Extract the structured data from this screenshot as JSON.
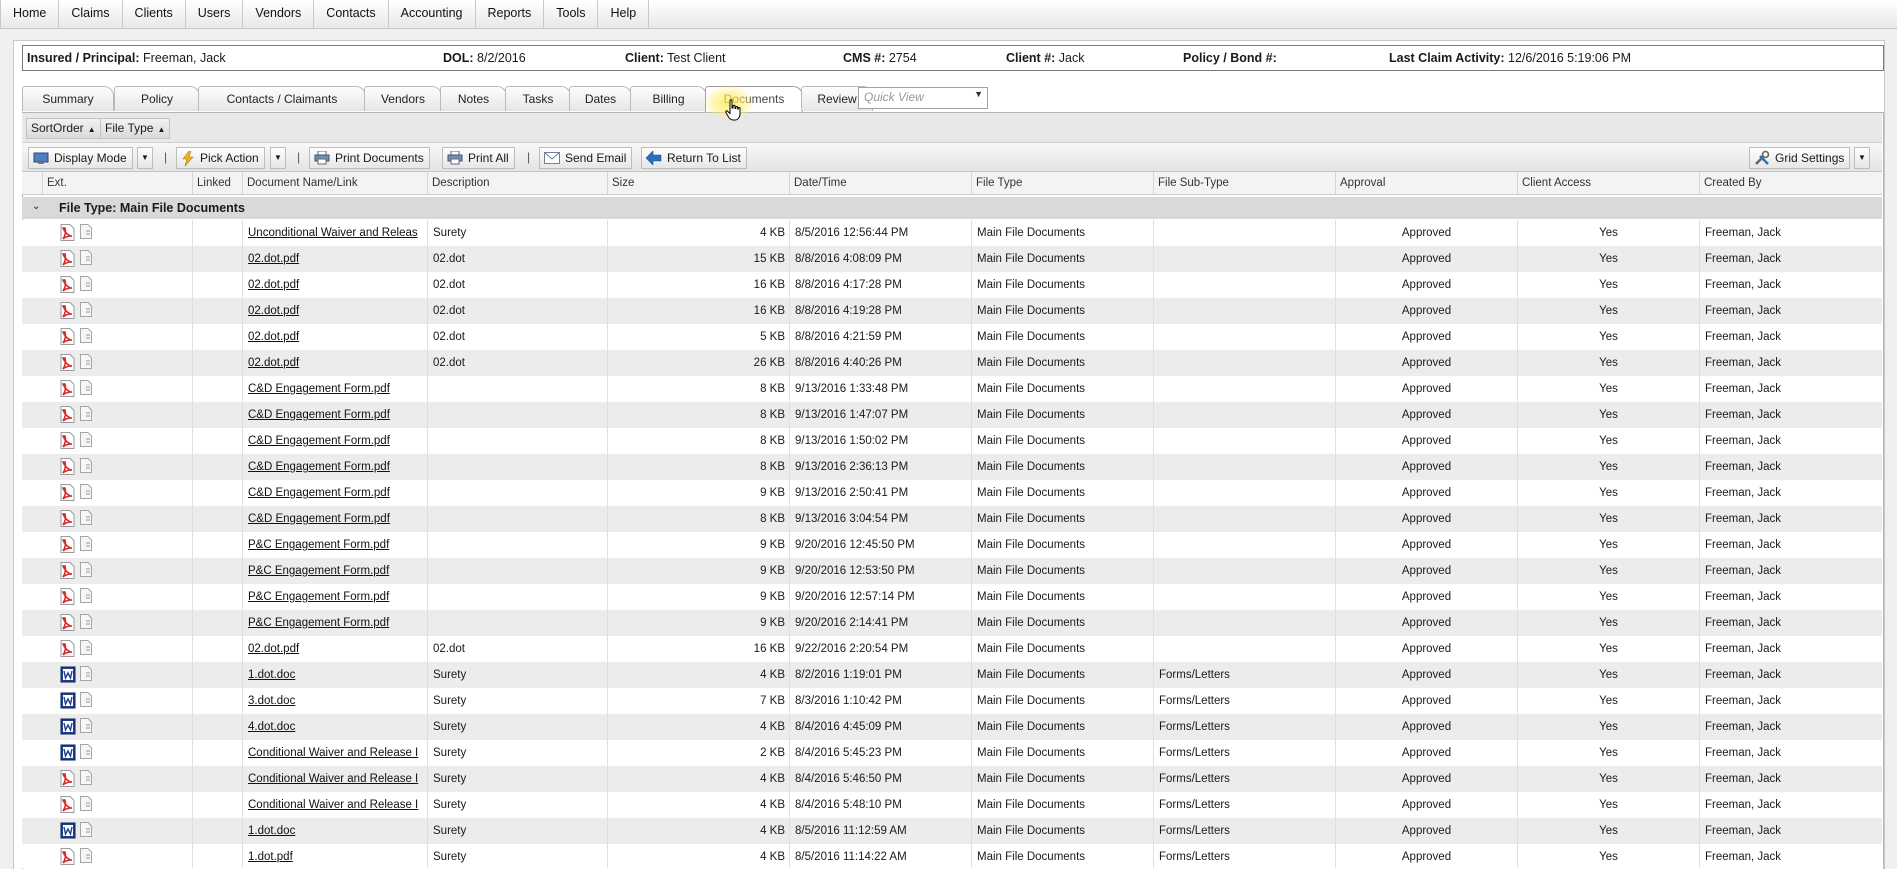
{
  "menu": [
    "Home",
    "Claims",
    "Clients",
    "Users",
    "Vendors",
    "Contacts",
    "Accounting",
    "Reports",
    "Tools",
    "Help"
  ],
  "info": {
    "insured_label": "Insured / Principal:",
    "insured_value": "Freeman, Jack",
    "dol_label": "DOL:",
    "dol_value": "8/2/2016",
    "client_label": "Client:",
    "client_value": "Test Client",
    "cms_label": "CMS #:",
    "cms_value": "2754",
    "clientnum_label": "Client #:",
    "clientnum_value": "Jack",
    "policy_label": "Policy / Bond #:",
    "policy_value": "",
    "lastact_label": "Last Claim Activity:",
    "lastact_value": "12/6/2016 5:19:06 PM"
  },
  "tabs": [
    "Summary",
    "Policy",
    "Contacts / Claimants",
    "Vendors",
    "Notes",
    "Tasks",
    "Dates",
    "Billing",
    "Documents",
    "Review"
  ],
  "active_tab": "Documents",
  "quick_view": {
    "placeholder": "Quick View"
  },
  "grouping": [
    "SortOrder",
    "File Type"
  ],
  "toolbar": {
    "display_mode": "Display Mode",
    "pick_action": "Pick Action",
    "print_documents": "Print Documents",
    "print_all": "Print All",
    "send_email": "Send Email",
    "return_to_list": "Return To List",
    "grid_settings": "Grid Settings",
    "separator": "|"
  },
  "columns": [
    "Ext.",
    "Linked",
    "Document Name/Link",
    "Description",
    "Size",
    "Date/Time",
    "File Type",
    "File Sub-Type",
    "Approval",
    "Client Access",
    "Created By"
  ],
  "group_row": {
    "label": "File Type: Main File Documents"
  },
  "icons": {
    "pdf": "pdf-file-icon",
    "doc": "word-doc-icon",
    "link": "linked-doc-icon"
  },
  "colors": {
    "pdf_red": "#d0302b",
    "doc_blue": "#1f3f8f",
    "accent": "#2e6fbd"
  },
  "rows": [
    {
      "type": "pdf",
      "name": "Unconditional Waiver and Releas",
      "desc": "Surety",
      "size": "4 KB",
      "date": "8/5/2016 12:56:44 PM",
      "ftype": "Main File Documents",
      "subtype": "",
      "approval": "Approved",
      "access": "Yes",
      "created": "Freeman, Jack"
    },
    {
      "type": "pdf",
      "name": "02.dot.pdf",
      "desc": "02.dot",
      "size": "15 KB",
      "date": "8/8/2016 4:08:09 PM",
      "ftype": "Main File Documents",
      "subtype": "",
      "approval": "Approved",
      "access": "Yes",
      "created": "Freeman, Jack"
    },
    {
      "type": "pdf",
      "name": "02.dot.pdf",
      "desc": "02.dot",
      "size": "16 KB",
      "date": "8/8/2016 4:17:28 PM",
      "ftype": "Main File Documents",
      "subtype": "",
      "approval": "Approved",
      "access": "Yes",
      "created": "Freeman, Jack"
    },
    {
      "type": "pdf",
      "name": "02.dot.pdf",
      "desc": "02.dot",
      "size": "16 KB",
      "date": "8/8/2016 4:19:28 PM",
      "ftype": "Main File Documents",
      "subtype": "",
      "approval": "Approved",
      "access": "Yes",
      "created": "Freeman, Jack"
    },
    {
      "type": "pdf",
      "name": "02.dot.pdf",
      "desc": "02.dot",
      "size": "5 KB",
      "date": "8/8/2016 4:21:59 PM",
      "ftype": "Main File Documents",
      "subtype": "",
      "approval": "Approved",
      "access": "Yes",
      "created": "Freeman, Jack"
    },
    {
      "type": "pdf",
      "name": "02.dot.pdf",
      "desc": "02.dot",
      "size": "26 KB",
      "date": "8/8/2016 4:40:26 PM",
      "ftype": "Main File Documents",
      "subtype": "",
      "approval": "Approved",
      "access": "Yes",
      "created": "Freeman, Jack"
    },
    {
      "type": "pdf",
      "name": "C&D Engagement Form.pdf",
      "desc": "",
      "size": "8 KB",
      "date": "9/13/2016 1:33:48 PM",
      "ftype": "Main File Documents",
      "subtype": "",
      "approval": "Approved",
      "access": "Yes",
      "created": "Freeman, Jack"
    },
    {
      "type": "pdf",
      "name": "C&D Engagement Form.pdf",
      "desc": "",
      "size": "8 KB",
      "date": "9/13/2016 1:47:07 PM",
      "ftype": "Main File Documents",
      "subtype": "",
      "approval": "Approved",
      "access": "Yes",
      "created": "Freeman, Jack"
    },
    {
      "type": "pdf",
      "name": "C&D Engagement Form.pdf",
      "desc": "",
      "size": "8 KB",
      "date": "9/13/2016 1:50:02 PM",
      "ftype": "Main File Documents",
      "subtype": "",
      "approval": "Approved",
      "access": "Yes",
      "created": "Freeman, Jack"
    },
    {
      "type": "pdf",
      "name": "C&D Engagement Form.pdf",
      "desc": "",
      "size": "8 KB",
      "date": "9/13/2016 2:36:13 PM",
      "ftype": "Main File Documents",
      "subtype": "",
      "approval": "Approved",
      "access": "Yes",
      "created": "Freeman, Jack"
    },
    {
      "type": "pdf",
      "name": "C&D Engagement Form.pdf",
      "desc": "",
      "size": "9 KB",
      "date": "9/13/2016 2:50:41 PM",
      "ftype": "Main File Documents",
      "subtype": "",
      "approval": "Approved",
      "access": "Yes",
      "created": "Freeman, Jack"
    },
    {
      "type": "pdf",
      "name": "C&D Engagement Form.pdf",
      "desc": "",
      "size": "8 KB",
      "date": "9/13/2016 3:04:54 PM",
      "ftype": "Main File Documents",
      "subtype": "",
      "approval": "Approved",
      "access": "Yes",
      "created": "Freeman, Jack"
    },
    {
      "type": "pdf",
      "name": "P&C Engagement Form.pdf",
      "desc": "",
      "size": "9 KB",
      "date": "9/20/2016 12:45:50 PM",
      "ftype": "Main File Documents",
      "subtype": "",
      "approval": "Approved",
      "access": "Yes",
      "created": "Freeman, Jack"
    },
    {
      "type": "pdf",
      "name": "P&C Engagement Form.pdf",
      "desc": "",
      "size": "9 KB",
      "date": "9/20/2016 12:53:50 PM",
      "ftype": "Main File Documents",
      "subtype": "",
      "approval": "Approved",
      "access": "Yes",
      "created": "Freeman, Jack"
    },
    {
      "type": "pdf",
      "name": "P&C Engagement Form.pdf",
      "desc": "",
      "size": "9 KB",
      "date": "9/20/2016 12:57:14 PM",
      "ftype": "Main File Documents",
      "subtype": "",
      "approval": "Approved",
      "access": "Yes",
      "created": "Freeman, Jack"
    },
    {
      "type": "pdf",
      "name": "P&C Engagement Form.pdf",
      "desc": "",
      "size": "9 KB",
      "date": "9/20/2016 2:14:41 PM",
      "ftype": "Main File Documents",
      "subtype": "",
      "approval": "Approved",
      "access": "Yes",
      "created": "Freeman, Jack"
    },
    {
      "type": "pdf",
      "name": "02.dot.pdf",
      "desc": "02.dot",
      "size": "16 KB",
      "date": "9/22/2016 2:20:54 PM",
      "ftype": "Main File Documents",
      "subtype": "",
      "approval": "Approved",
      "access": "Yes",
      "created": "Freeman, Jack"
    },
    {
      "type": "doc",
      "name": "1.dot.doc",
      "desc": "Surety",
      "size": "4 KB",
      "date": "8/2/2016 1:19:01 PM",
      "ftype": "Main File Documents",
      "subtype": "Forms/Letters",
      "approval": "Approved",
      "access": "Yes",
      "created": "Freeman, Jack"
    },
    {
      "type": "doc",
      "name": "3.dot.doc",
      "desc": "Surety",
      "size": "7 KB",
      "date": "8/3/2016 1:10:42 PM",
      "ftype": "Main File Documents",
      "subtype": "Forms/Letters",
      "approval": "Approved",
      "access": "Yes",
      "created": "Freeman, Jack"
    },
    {
      "type": "doc",
      "name": "4.dot.doc",
      "desc": "Surety",
      "size": "4 KB",
      "date": "8/4/2016 4:45:09 PM",
      "ftype": "Main File Documents",
      "subtype": "Forms/Letters",
      "approval": "Approved",
      "access": "Yes",
      "created": "Freeman, Jack"
    },
    {
      "type": "doc",
      "name": "Conditional Waiver and Release I",
      "desc": "Surety",
      "size": "2 KB",
      "date": "8/4/2016 5:45:23 PM",
      "ftype": "Main File Documents",
      "subtype": "Forms/Letters",
      "approval": "Approved",
      "access": "Yes",
      "created": "Freeman, Jack"
    },
    {
      "type": "pdf",
      "name": "Conditional Waiver and Release I",
      "desc": "Surety",
      "size": "4 KB",
      "date": "8/4/2016 5:46:50 PM",
      "ftype": "Main File Documents",
      "subtype": "Forms/Letters",
      "approval": "Approved",
      "access": "Yes",
      "created": "Freeman, Jack"
    },
    {
      "type": "pdf",
      "name": "Conditional Waiver and Release I",
      "desc": "Surety",
      "size": "4 KB",
      "date": "8/4/2016 5:48:10 PM",
      "ftype": "Main File Documents",
      "subtype": "Forms/Letters",
      "approval": "Approved",
      "access": "Yes",
      "created": "Freeman, Jack"
    },
    {
      "type": "doc",
      "name": "1.dot.doc",
      "desc": "Surety",
      "size": "4 KB",
      "date": "8/5/2016 11:12:59 AM",
      "ftype": "Main File Documents",
      "subtype": "Forms/Letters",
      "approval": "Approved",
      "access": "Yes",
      "created": "Freeman, Jack"
    },
    {
      "type": "pdf",
      "name": "1.dot.pdf",
      "desc": "Surety",
      "size": "4 KB",
      "date": "8/5/2016 11:14:22 AM",
      "ftype": "Main File Documents",
      "subtype": "Forms/Letters",
      "approval": "Approved",
      "access": "Yes",
      "created": "Freeman, Jack"
    }
  ]
}
